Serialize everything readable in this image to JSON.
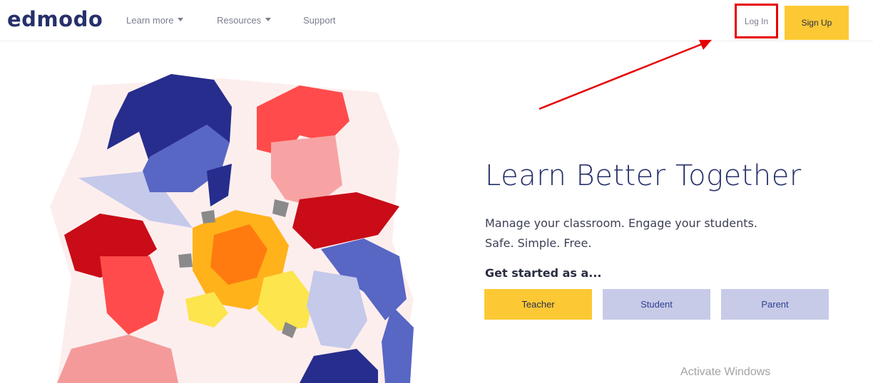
{
  "header": {
    "logo": "edmodo",
    "nav": [
      {
        "label": "Learn more",
        "has_dropdown": true
      },
      {
        "label": "Resources",
        "has_dropdown": true
      },
      {
        "label": "Support",
        "has_dropdown": false
      }
    ],
    "login_label": "Log In",
    "signup_label": "Sign Up"
  },
  "hero": {
    "title": "Learn Better Together",
    "subtitle_line1": "Manage your classroom. Engage your students.",
    "subtitle_line2": "Safe. Simple. Free.",
    "get_started": "Get started as a...",
    "roles": {
      "teacher": "Teacher",
      "student": "Student",
      "parent": "Parent"
    }
  },
  "watermark": "Activate Windows",
  "colors": {
    "brand_navy": "#27306b",
    "primary_yellow": "#fcc934",
    "secondary_lavender": "#c7cbe8",
    "annotation_red": "#e60000"
  },
  "icons": {
    "nav_dropdown": "caret-down-icon",
    "annotation": "red-arrow-annotation"
  }
}
